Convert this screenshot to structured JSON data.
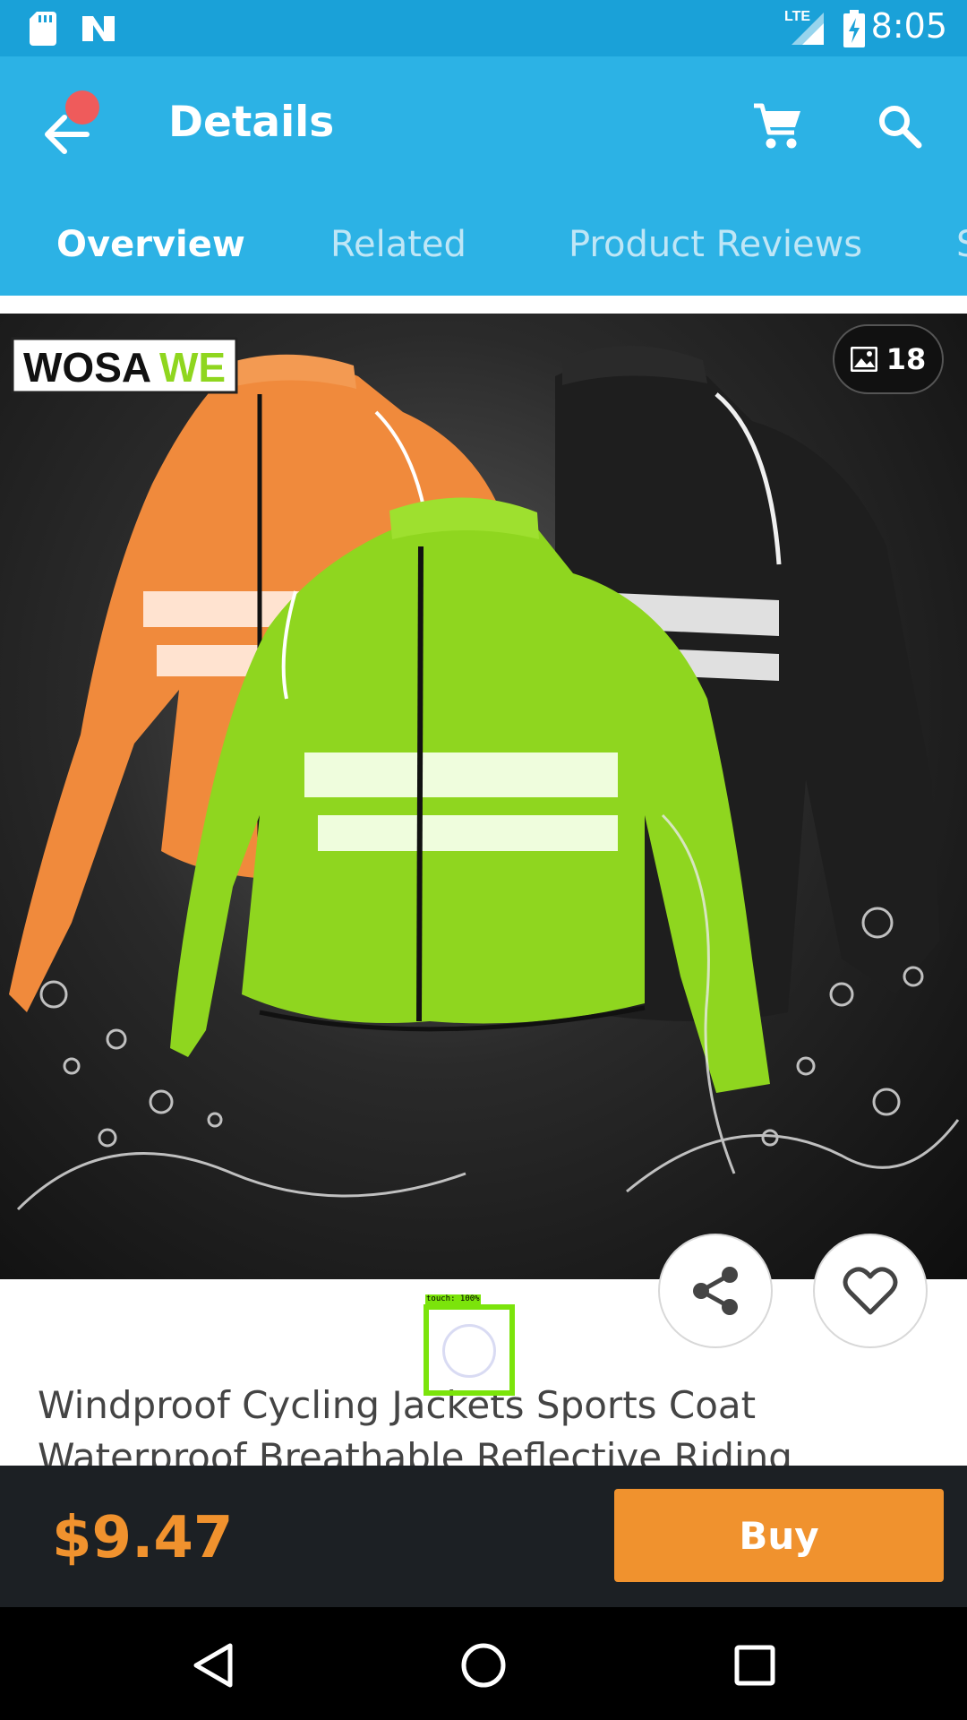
{
  "status_bar": {
    "time": "8:05",
    "network": "LTE",
    "icons": [
      "sd-card-icon",
      "n-notification-icon",
      "signal-icon",
      "battery-charging-icon"
    ]
  },
  "app_bar": {
    "title": "Details",
    "icons": [
      "back-arrow-icon",
      "cart-icon",
      "search-icon"
    ],
    "accent_color": "#2cb2e5"
  },
  "tabs": [
    {
      "label": "Overview",
      "active": true
    },
    {
      "label": "Related",
      "active": false
    },
    {
      "label": "Product Reviews",
      "active": false
    },
    {
      "label": "S",
      "active": false
    }
  ],
  "hero": {
    "brand_logo": "WOSAWE",
    "photo_count": "18",
    "jacket_colors": [
      "#f08a3c",
      "#1e1e1e",
      "#8fd61f"
    ]
  },
  "touch_overlay": {
    "label": "touch: 100%"
  },
  "product": {
    "title_line1": "Windproof Cycling Jackets Sports Coat",
    "title_line2": "Waterproof Breathable Reflective Riding"
  },
  "buy_bar": {
    "price": "$9.47",
    "buy_label": "Buy",
    "price_color": "#f0922e"
  },
  "nav_bar": {
    "icons": [
      "back-triangle-icon",
      "home-circle-icon",
      "recents-square-icon"
    ]
  }
}
